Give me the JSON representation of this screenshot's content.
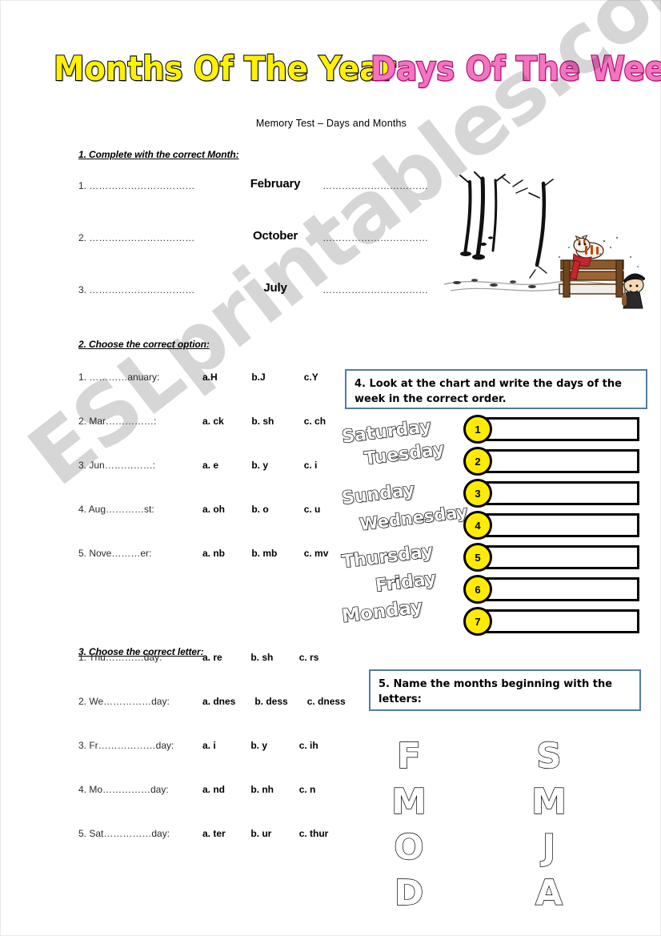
{
  "page": {
    "watermark": "ESLprintables.com",
    "subtitle": "Memory Test – Days and Months"
  },
  "titles": {
    "months": "Months Of The Year",
    "days": "Days Of The Week",
    "months_color": "#FFF200",
    "days_color": "#F375C0"
  },
  "section1": {
    "heading": "1. Complete with the correct Month:",
    "rows": [
      {
        "number": "1. ……………………………",
        "month": "February",
        "answer": "……………………………"
      },
      {
        "number": "2. ……………………………",
        "month": "October",
        "answer": "……………………………"
      },
      {
        "number": "3. ……………………………",
        "month": "July",
        "answer": "……………………………"
      }
    ]
  },
  "section2": {
    "heading": "2. Choose the correct option:",
    "rows": [
      {
        "q": "1. …………anuary:",
        "a": "a.H",
        "b": "b.J",
        "c": "c.Y"
      },
      {
        "q": "2. Mar……………:",
        "a": "a. ck",
        "b": "b. sh",
        "c": "c. ch"
      },
      {
        "q": "3. Jun……………:",
        "a": "a. e",
        "b": "b. y",
        "c": "c. i"
      },
      {
        "q": "4. Aug…………st:",
        "a": "a. oh",
        "b": "b. o",
        "c": "c. u"
      },
      {
        "q": "5. Nove………er:",
        "a": "a. nb",
        "b": "b. mb",
        "c": "c. mv"
      }
    ]
  },
  "section3": {
    "heading": "3. Choose the correct letter:",
    "rows": [
      {
        "q": "1. Thu…………day:",
        "a": "a. re",
        "b": "b. sh",
        "c": "c. rs"
      },
      {
        "q": "2. We……………day:",
        "a": "a. dnes",
        "b": "b. dess",
        "c": "c. dness"
      },
      {
        "q": "3. Fr………………day:",
        "a": "a. i",
        "b": "b. y",
        "c": "c. ih"
      },
      {
        "q": "4. Mo……………day:",
        "a": "a. nd",
        "b": "b. nh",
        "c": "c. n"
      },
      {
        "q": "5. Sat……………day:",
        "a": "a. ter",
        "b": "b. ur",
        "c": "c. thur"
      }
    ]
  },
  "section4": {
    "instruction": "4. Look at the chart and write the days of the week in the correct order.",
    "scattered_days": [
      "Saturday",
      "Tuesday",
      "Sunday",
      "Wednesday",
      "Thursday",
      "Friday",
      "Monday"
    ],
    "numbers": [
      "1",
      "2",
      "3",
      "4",
      "5",
      "6",
      "7"
    ],
    "circle_color": "#FFEC00"
  },
  "section5": {
    "instruction": "5. Name the months beginning with the letters:",
    "left_letters": [
      "F",
      "M",
      "O",
      "D"
    ],
    "right_letters": [
      "S",
      "M",
      "J",
      "A"
    ]
  }
}
